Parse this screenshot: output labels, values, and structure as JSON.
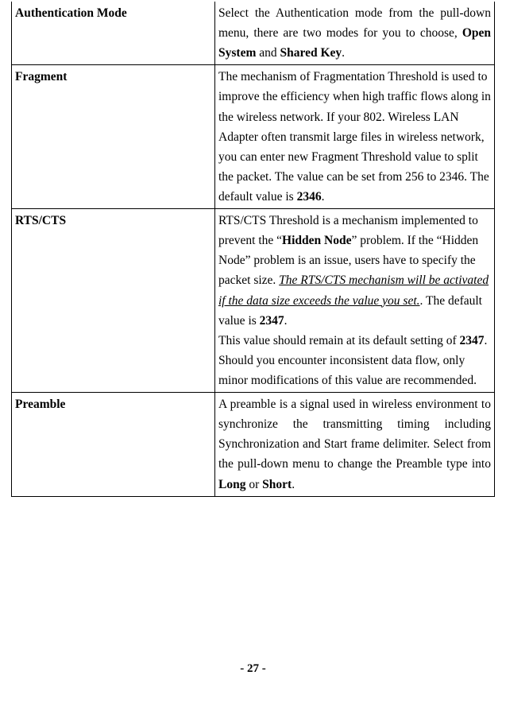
{
  "rows": [
    {
      "name": "authentication-mode",
      "label": "Authentication Mode",
      "desc_pre": "Select the Authentication mode from the pull-down menu, there are two modes for you to choose, ",
      "b1": "Open System",
      "mid": " and ",
      "b2": "Shared Key",
      "post": ".",
      "justify": true
    },
    {
      "name": "fragment",
      "label": "Fragment",
      "desc_pre": "The mechanism of Fragmentation Threshold is used to improve the efficiency when high traffic flows along in the wireless network. If your 802. Wireless LAN Adapter often transmit large files in wireless network, you can enter new Fragment Threshold value to split the packet.   The value can be set from 256 to 2346. The default value is ",
      "b1": "2346",
      "mid": "",
      "b2": "",
      "post": ".",
      "justify": false
    },
    {
      "name": "rts-cts",
      "label": "RTS/CTS",
      "p1_pre": "RTS/CTS Threshold is a mechanism implemented to prevent the “",
      "p1_b1": "Hidden Node",
      "p1_mid1": "” problem. If the “Hidden Node” problem is an issue, users have to specify the packet size. ",
      "p1_iu": "The RTS/CTS mechanism will be activated if the data size exceeds the value you set.",
      "p1_mid2": ". The default value is ",
      "p1_b2": "2347",
      "p1_post": ".",
      "p2_pre": "This value should remain at its default setting of ",
      "p2_b1": "2347",
      "p2_post": ".   Should you encounter inconsistent data flow, only minor modifications of this value are recommended.",
      "justify": false
    },
    {
      "name": "preamble",
      "label": "Preamble",
      "desc_pre": "A preamble is a signal used in wireless environment to synchronize the transmitting timing including Synchronization and Start frame delimiter. Select from the pull-down menu to change the Preamble type into ",
      "b1": "Long",
      "mid": " or ",
      "b2": "Short",
      "post": ".",
      "justify": true
    }
  ],
  "footer": "- 27 -"
}
